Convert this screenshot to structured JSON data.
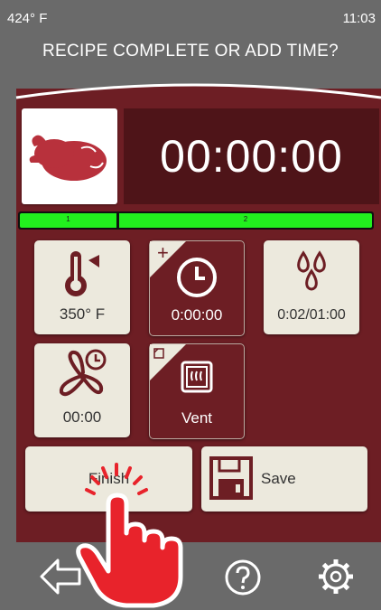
{
  "status": {
    "temperature": "424° F",
    "time": "11:03"
  },
  "title": "RECIPE COMPLETE OR ADD TIME?",
  "food_icon": "whole-chicken-icon",
  "timer": "00:00:00",
  "progress": {
    "segments": [
      {
        "label": "1",
        "color": "#22f01e"
      },
      {
        "label": "2",
        "color": "#22f01e"
      }
    ]
  },
  "tiles": {
    "temperature": {
      "label": "350° F",
      "icon": "thermometer-icon"
    },
    "add_time": {
      "label": "0:00:00",
      "icon": "clock-icon",
      "corner": "+"
    },
    "humidity": {
      "label": "0:02/01:00",
      "icon": "water-drops-icon"
    },
    "fan": {
      "label": "00:00",
      "icon": "fan-timer-icon"
    },
    "vent": {
      "label": "Vent",
      "icon": "vent-icon"
    }
  },
  "buttons": {
    "finish": {
      "label": "Finish"
    },
    "save": {
      "label": "Save",
      "icon": "floppy-disk-icon"
    }
  },
  "bottom_nav": [
    {
      "name": "back",
      "icon": "back-arrow-icon"
    },
    {
      "name": "help",
      "icon": "help-icon"
    },
    {
      "name": "settings",
      "icon": "gear-icon"
    }
  ],
  "overlay": {
    "icon": "tap-hand-icon",
    "color": "#e8232b"
  },
  "colors": {
    "panel": "#6d1e24",
    "timer_bg": "#4e1418",
    "tile": "#ece9dd",
    "progress": "#22f01e",
    "background": "#6a6a6a"
  }
}
